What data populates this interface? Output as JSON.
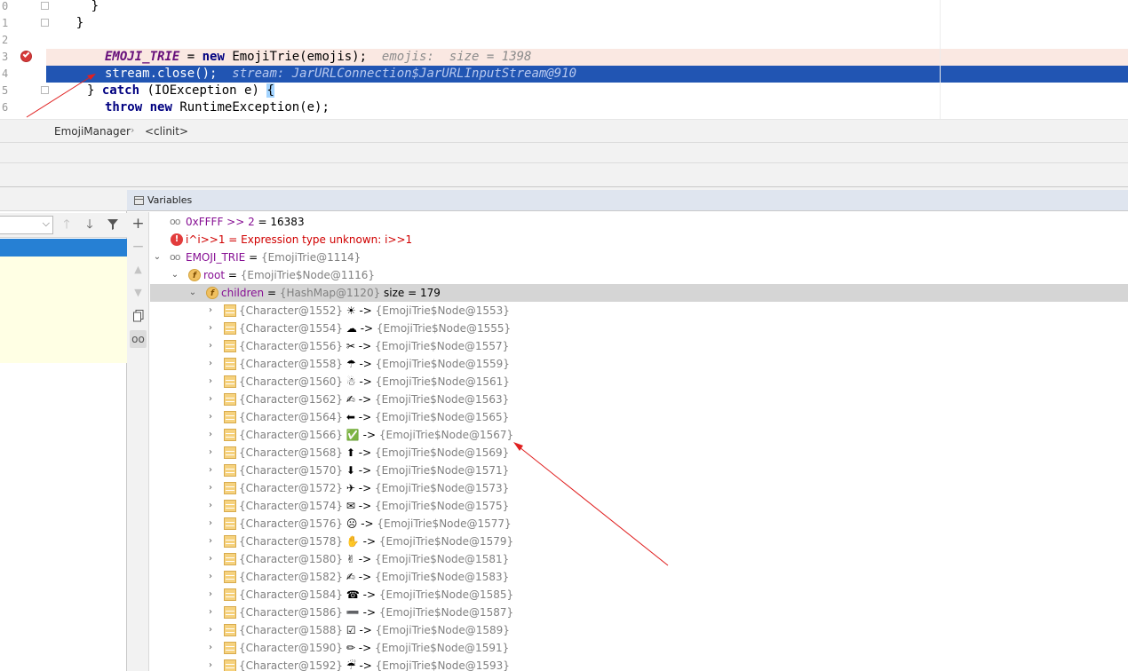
{
  "editor": {
    "lines": [
      {
        "num": "0",
        "text": "      }"
      },
      {
        "num": "1",
        "text": "    }"
      },
      {
        "num": "2",
        "text": ""
      },
      {
        "num": "3",
        "field": "EMOJI_TRIE",
        "op": " = ",
        "kw": "new",
        "rest": " EmojiTrie(emojis);",
        "hint": "emojis:  size = 1398"
      },
      {
        "num": "4",
        "text": "stream.close();",
        "hint": "stream: JarURLConnection$JarURLInputStream@910"
      },
      {
        "num": "5",
        "pre": "} ",
        "kw": "catch",
        "rest": " (IOException e) ",
        "brace": "{"
      },
      {
        "num": "6",
        "kw": "throw",
        "kw2": "new",
        "rest": " RuntimeException(e);"
      }
    ]
  },
  "breadcrumb": {
    "items": [
      "EmojiManager",
      "<clinit>"
    ],
    "separator": "›"
  },
  "frames": {
    "toolbar": {
      "up_icon": "arrow-up-icon",
      "down_icon": "arrow-down-icon",
      "filter_icon": "filter-icon",
      "dropdown_icon": "chevron-down-icon"
    }
  },
  "variables": {
    "title": "Variables",
    "side_icons": [
      "add-icon",
      "remove-icon",
      "move-up-icon",
      "move-down-icon",
      "copy-icon",
      "watch-icon"
    ],
    "rows": [
      {
        "depth": 0,
        "arrow": "",
        "icon": "watch",
        "name": "0xFFFF >> 2",
        "eq": " = ",
        "value": "16383",
        "type": ""
      },
      {
        "depth": 0,
        "arrow": "",
        "icon": "error",
        "name": "i^i>>1",
        "eq": " = ",
        "value": "Expression type unknown: i>>1",
        "type": "",
        "error": true
      },
      {
        "depth": 0,
        "arrow": "expanded",
        "icon": "watch",
        "name": "EMOJI_TRIE",
        "eq": " = ",
        "value": "",
        "type": "{EmojiTrie@1114}"
      },
      {
        "depth": 1,
        "arrow": "expanded",
        "icon": "field",
        "name": "root",
        "eq": " = ",
        "value": "",
        "type": "{EmojiTrie$Node@1116}"
      },
      {
        "depth": 2,
        "arrow": "expanded",
        "icon": "field",
        "name": "children",
        "eq": " = ",
        "value": "",
        "type": "{HashMap@1120}",
        "size": " size = 179",
        "selected": true
      },
      {
        "depth": 3,
        "arrow": "collapsed",
        "icon": "entry",
        "key": "{Character@1552}",
        "glyph": "☀",
        "arrow_text": " -> ",
        "node": "{EmojiTrie$Node@1553}"
      },
      {
        "depth": 3,
        "arrow": "collapsed",
        "icon": "entry",
        "key": "{Character@1554}",
        "glyph": "☁",
        "arrow_text": " -> ",
        "node": "{EmojiTrie$Node@1555}"
      },
      {
        "depth": 3,
        "arrow": "collapsed",
        "icon": "entry",
        "key": "{Character@1556}",
        "glyph": "✂",
        "arrow_text": " -> ",
        "node": "{EmojiTrie$Node@1557}"
      },
      {
        "depth": 3,
        "arrow": "collapsed",
        "icon": "entry",
        "key": "{Character@1558}",
        "glyph": "☂",
        "arrow_text": " -> ",
        "node": "{EmojiTrie$Node@1559}"
      },
      {
        "depth": 3,
        "arrow": "collapsed",
        "icon": "entry",
        "key": "{Character@1560}",
        "glyph": "☃",
        "arrow_text": " -> ",
        "node": "{EmojiTrie$Node@1561}"
      },
      {
        "depth": 3,
        "arrow": "collapsed",
        "icon": "entry",
        "key": "{Character@1562}",
        "glyph": "✍",
        "arrow_text": " -> ",
        "node": "{EmojiTrie$Node@1563}"
      },
      {
        "depth": 3,
        "arrow": "collapsed",
        "icon": "entry",
        "key": "{Character@1564}",
        "glyph": "⬅",
        "arrow_text": " -> ",
        "node": "{EmojiTrie$Node@1565}"
      },
      {
        "depth": 3,
        "arrow": "collapsed",
        "icon": "entry",
        "key": "{Character@1566}",
        "glyph": "✅",
        "arrow_text": " -> ",
        "node": "{EmojiTrie$Node@1567}"
      },
      {
        "depth": 3,
        "arrow": "collapsed",
        "icon": "entry",
        "key": "{Character@1568}",
        "glyph": "⬆",
        "arrow_text": " -> ",
        "node": "{EmojiTrie$Node@1569}"
      },
      {
        "depth": 3,
        "arrow": "collapsed",
        "icon": "entry",
        "key": "{Character@1570}",
        "glyph": "⬇",
        "arrow_text": " -> ",
        "node": "{EmojiTrie$Node@1571}"
      },
      {
        "depth": 3,
        "arrow": "collapsed",
        "icon": "entry",
        "key": "{Character@1572}",
        "glyph": "✈",
        "arrow_text": " -> ",
        "node": "{EmojiTrie$Node@1573}"
      },
      {
        "depth": 3,
        "arrow": "collapsed",
        "icon": "entry",
        "key": "{Character@1574}",
        "glyph": "✉",
        "arrow_text": " -> ",
        "node": "{EmojiTrie$Node@1575}"
      },
      {
        "depth": 3,
        "arrow": "collapsed",
        "icon": "entry",
        "key": "{Character@1576}",
        "glyph": "☹",
        "arrow_text": " -> ",
        "node": "{EmojiTrie$Node@1577}"
      },
      {
        "depth": 3,
        "arrow": "collapsed",
        "icon": "entry",
        "key": "{Character@1578}",
        "glyph": "✋",
        "arrow_text": " -> ",
        "node": "{EmojiTrie$Node@1579}"
      },
      {
        "depth": 3,
        "arrow": "collapsed",
        "icon": "entry",
        "key": "{Character@1580}",
        "glyph": "✌",
        "arrow_text": " -> ",
        "node": "{EmojiTrie$Node@1581}"
      },
      {
        "depth": 3,
        "arrow": "collapsed",
        "icon": "entry",
        "key": "{Character@1582}",
        "glyph": "✍",
        "arrow_text": " -> ",
        "node": "{EmojiTrie$Node@1583}"
      },
      {
        "depth": 3,
        "arrow": "collapsed",
        "icon": "entry",
        "key": "{Character@1584}",
        "glyph": "☎",
        "arrow_text": " -> ",
        "node": "{EmojiTrie$Node@1585}"
      },
      {
        "depth": 3,
        "arrow": "collapsed",
        "icon": "entry",
        "key": "{Character@1586}",
        "glyph": "➖",
        "arrow_text": " -> ",
        "node": "{EmojiTrie$Node@1587}"
      },
      {
        "depth": 3,
        "arrow": "collapsed",
        "icon": "entry",
        "key": "{Character@1588}",
        "glyph": "☑",
        "arrow_text": " -> ",
        "node": "{EmojiTrie$Node@1589}"
      },
      {
        "depth": 3,
        "arrow": "collapsed",
        "icon": "entry",
        "key": "{Character@1590}",
        "glyph": "✏",
        "arrow_text": " -> ",
        "node": "{EmojiTrie$Node@1591}"
      },
      {
        "depth": 3,
        "arrow": "collapsed",
        "icon": "entry",
        "key": "{Character@1592}",
        "glyph": "☔",
        "arrow_text": " -> ",
        "node": "{EmojiTrie$Node@1593}"
      }
    ]
  },
  "colors": {
    "exec_line": "#2155b3",
    "breakpoint_line": "#fae8e2",
    "annotation_arrow": "#e02020",
    "selected_row": "#d5d5d5",
    "frame_selected": "#2680d4"
  }
}
